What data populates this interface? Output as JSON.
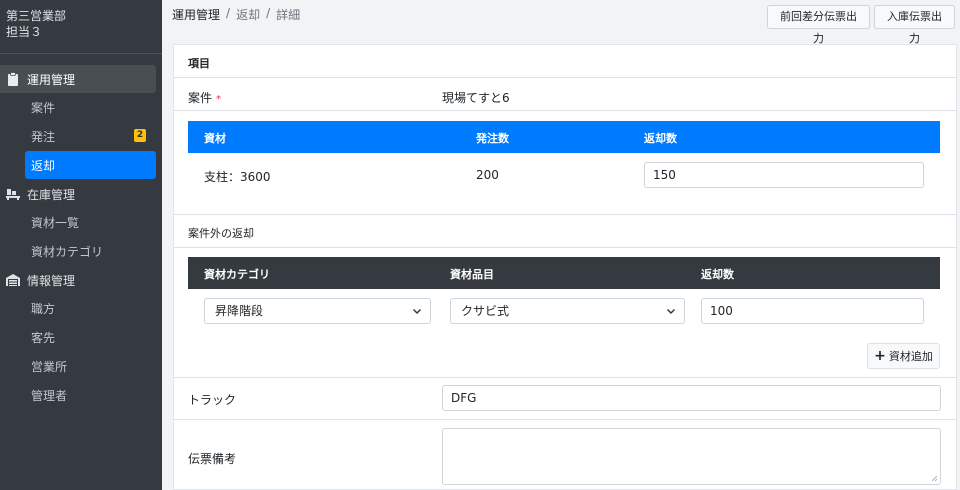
{
  "sidebar": {
    "user_line1": "第三営業部",
    "user_line2": "担当３",
    "groups": [
      {
        "label": "運用管理",
        "icon": "clipboard-icon",
        "items": [
          {
            "label": "案件"
          },
          {
            "label": "発注",
            "badge": "2"
          },
          {
            "label": "返却"
          }
        ]
      },
      {
        "label": "在庫管理",
        "icon": "pallet-icon",
        "items": [
          {
            "label": "資材一覧"
          },
          {
            "label": "資材カテゴリ"
          }
        ]
      },
      {
        "label": "情報管理",
        "icon": "warehouse-icon",
        "items": [
          {
            "label": "職方"
          },
          {
            "label": "客先"
          },
          {
            "label": "営業所"
          },
          {
            "label": "管理者"
          }
        ]
      }
    ]
  },
  "breadcrumb": {
    "first": "運用管理",
    "sep": "/",
    "second": "返却",
    "third": "詳細"
  },
  "toolbar": {
    "diff_label": "前回差分伝票出力",
    "nyuko_label": "入庫伝票出力"
  },
  "form": {
    "section_title": "項目",
    "anken_label": "案件",
    "required_mark": "*",
    "anken_value": "現場てすと6",
    "table1": {
      "headers": [
        "資材",
        "発注数",
        "返却数"
      ],
      "row": {
        "material": "支柱：3600",
        "ordered": "200",
        "returned": "150"
      }
    },
    "outside_label": "案件外の返却",
    "table2": {
      "headers": [
        "資材カテゴリ",
        "資材品目",
        "返却数"
      ],
      "row": {
        "category": "昇降階段",
        "item": "クサビ式",
        "returned": "100"
      }
    },
    "add_label": "資材追加",
    "truck_label": "トラック",
    "truck_value": "DFG",
    "memo_label": "伝票備考",
    "memo_value": ""
  },
  "colors": {
    "sidebar_bg": "#343a40",
    "primary": "#007bff",
    "badge": "#ffc107",
    "dark_header": "#343a40",
    "required": "#dc3545"
  }
}
